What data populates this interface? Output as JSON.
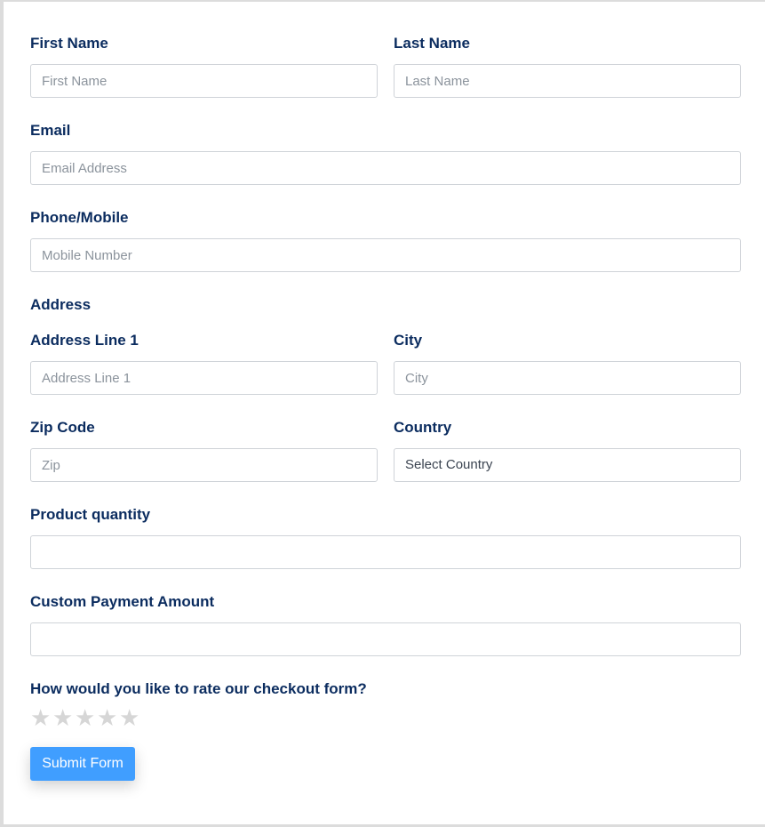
{
  "form": {
    "first_name": {
      "label": "First Name",
      "placeholder": "First Name"
    },
    "last_name": {
      "label": "Last Name",
      "placeholder": "Last Name"
    },
    "email": {
      "label": "Email",
      "placeholder": "Email Address"
    },
    "phone": {
      "label": "Phone/Mobile",
      "placeholder": "Mobile Number"
    },
    "address_section": "Address",
    "address_line1": {
      "label": "Address Line 1",
      "placeholder": "Address Line 1"
    },
    "city": {
      "label": "City",
      "placeholder": "City"
    },
    "zip": {
      "label": "Zip Code",
      "placeholder": "Zip"
    },
    "country": {
      "label": "Country",
      "selected": "Select Country"
    },
    "product_quantity": {
      "label": "Product quantity",
      "value": ""
    },
    "custom_payment": {
      "label": "Custom Payment Amount",
      "value": ""
    },
    "rating": {
      "label": "How would you like to rate our checkout form?",
      "max": 5,
      "value": 0,
      "star_icon": "star-icon",
      "star_color": "#d6d6d6"
    },
    "submit_label": "Submit Form",
    "accent_color": "#409eff",
    "label_color": "#0b2c5f"
  }
}
